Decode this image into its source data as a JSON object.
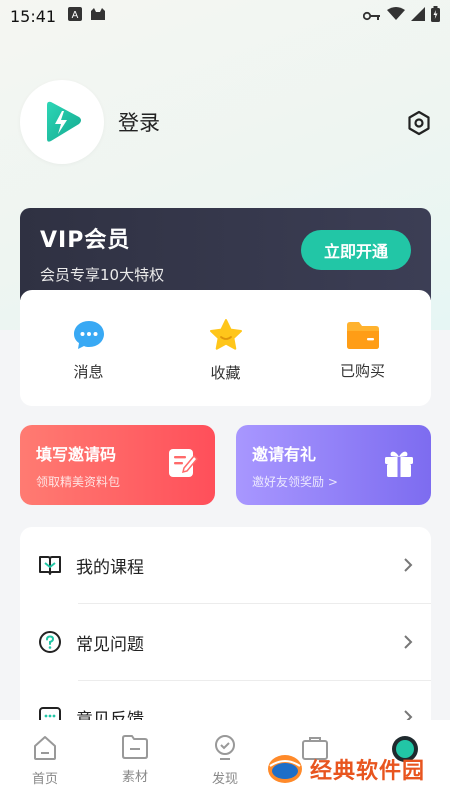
{
  "status_bar": {
    "time": "15:41"
  },
  "profile": {
    "login_label": "登录"
  },
  "vip": {
    "title": "VIP会员",
    "subtitle": "会员专享10大特权",
    "button_label": "立即开通"
  },
  "quick_actions": [
    {
      "label": "消息",
      "icon": "chat-icon"
    },
    {
      "label": "收藏",
      "icon": "star-icon"
    },
    {
      "label": "已购买",
      "icon": "folder-icon"
    }
  ],
  "promos": {
    "invite_code": {
      "title": "填写邀请码",
      "subtitle": "领取精美资料包"
    },
    "invite_gift": {
      "title": "邀请有礼",
      "subtitle": "邀好友领奖励 >"
    }
  },
  "menu": [
    {
      "label": "我的课程",
      "icon": "book-icon"
    },
    {
      "label": "常见问题",
      "icon": "question-icon"
    },
    {
      "label": "意见反馈",
      "icon": "feedback-icon"
    }
  ],
  "tabbar": [
    {
      "label": "首页",
      "icon": "home-icon"
    },
    {
      "label": "素材",
      "icon": "folder-icon"
    },
    {
      "label": "发现",
      "icon": "bulb-icon"
    },
    {
      "label": "",
      "icon": "briefcase-icon"
    },
    {
      "label": "",
      "icon": "profile-icon"
    }
  ],
  "watermark": {
    "text": "经典软件园"
  },
  "colors": {
    "accent": "#22c6a6",
    "vip_bg": "#2f3142",
    "promo_red": "#ff5a5f",
    "promo_purple": "#8b7bf6"
  }
}
